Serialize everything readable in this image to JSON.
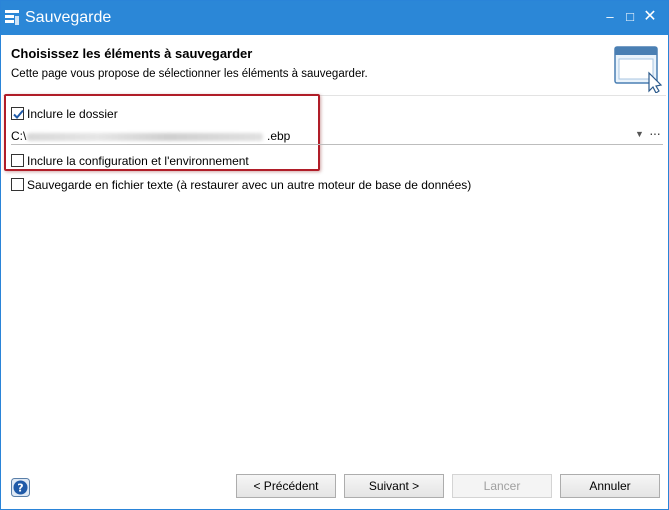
{
  "window": {
    "title": "Sauvegarde",
    "controls": {
      "minimize": "–",
      "maximize": "□",
      "close": "✕"
    }
  },
  "header": {
    "title": "Choisissez les éléments à sauvegarder",
    "subtitle": "Cette page vous propose de sélectionner les éléments à sauvegarder.",
    "icon": "window-cursor-icon"
  },
  "options": {
    "include_folder": {
      "label": "Inclure le dossier",
      "checked": true
    },
    "path": {
      "prefix": "C:\\",
      "suffix": ".ebp",
      "more_label": "···",
      "dropdown": "▼"
    },
    "include_config": {
      "label": "Inclure la configuration et l'environnement",
      "checked": false
    },
    "text_backup": {
      "label": "Sauvegarde en fichier texte (à restaurer avec un autre moteur de base de données)",
      "checked": false
    }
  },
  "footer": {
    "help_icon": "help-icon",
    "buttons": {
      "previous": "< Précédent",
      "next": "Suivant >",
      "launch": "Lancer",
      "cancel": "Annuler"
    }
  },
  "colors": {
    "titlebar": "#2b87d7",
    "highlight": "#b01d28"
  }
}
